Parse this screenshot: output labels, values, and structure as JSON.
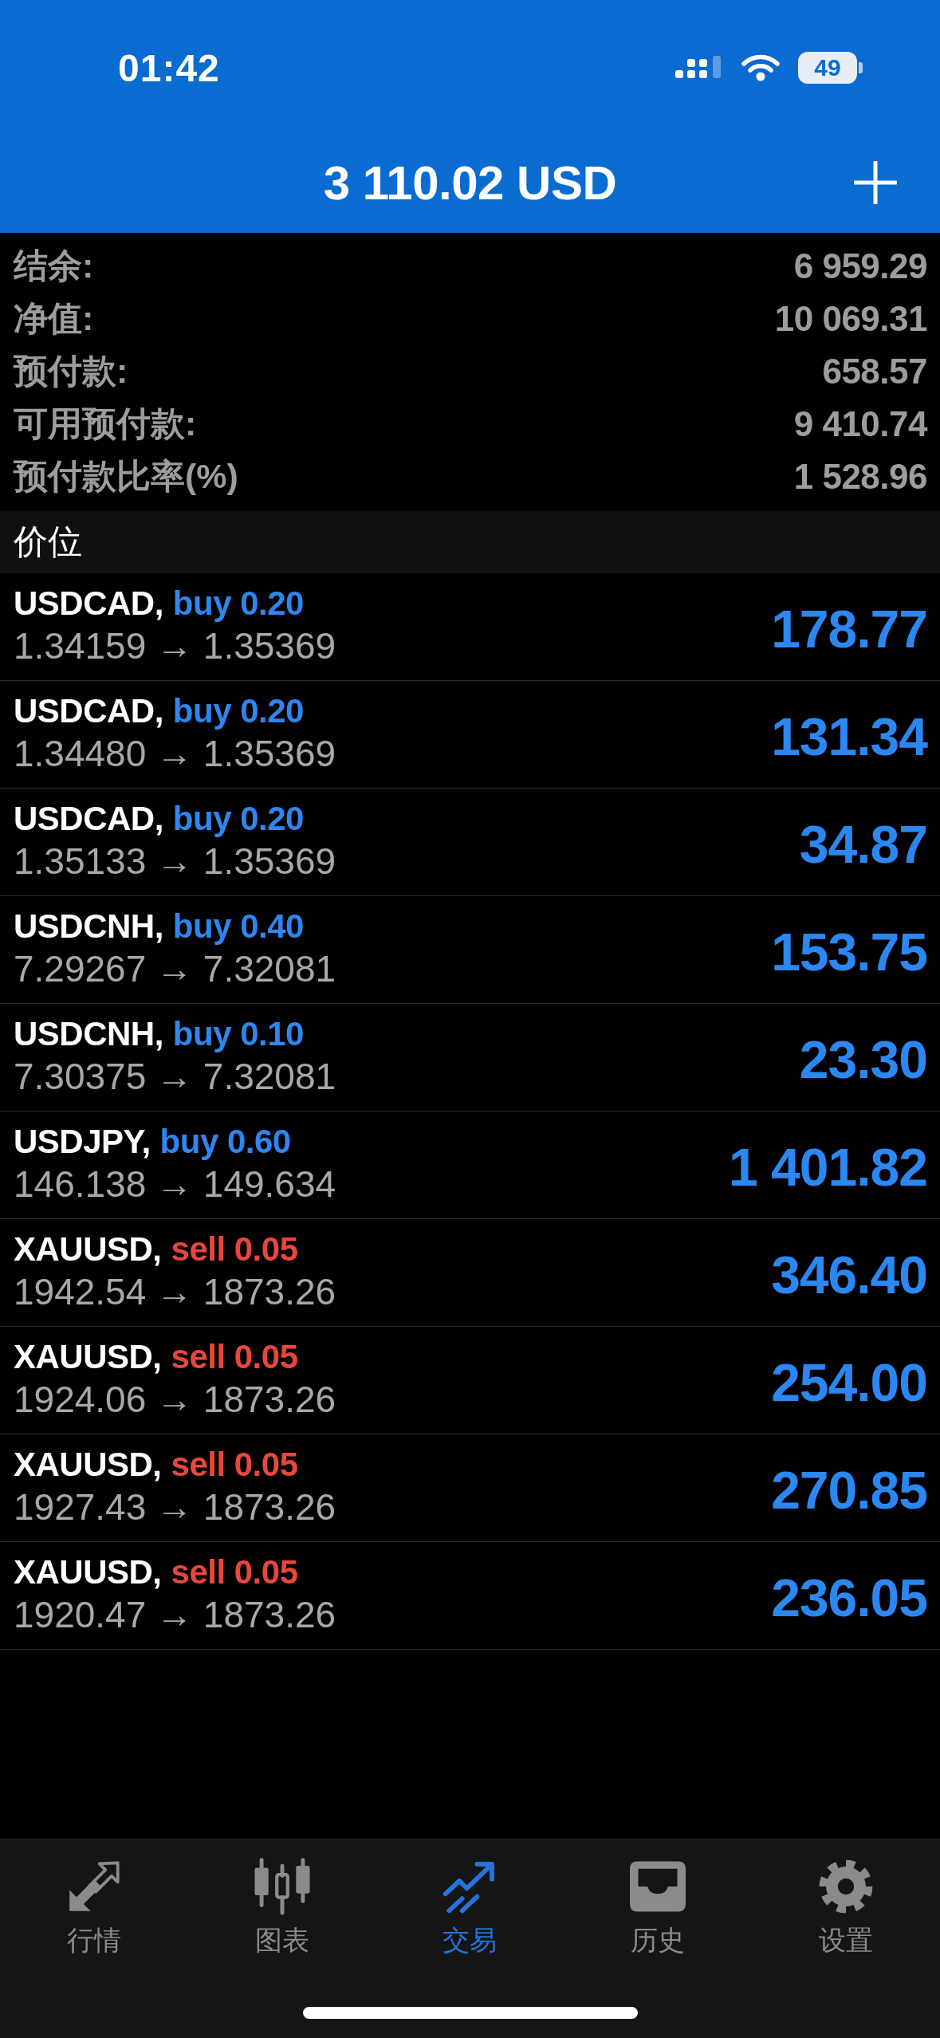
{
  "status_bar": {
    "time": "01:42",
    "battery": "49"
  },
  "header": {
    "title": "3 110.02 USD"
  },
  "summary": [
    {
      "label": "结余:",
      "value": "6 959.29"
    },
    {
      "label": "净值:",
      "value": "10 069.31"
    },
    {
      "label": "预付款:",
      "value": "658.57"
    },
    {
      "label": "可用预付款:",
      "value": "9 410.74"
    },
    {
      "label": "预付款比率(%)",
      "value": "1 528.96"
    }
  ],
  "section": {
    "title": "价位"
  },
  "positions": [
    {
      "symbol": "USDCAD,",
      "kind": "buy",
      "order": "buy 0.20",
      "prices": "1.34159 → 1.35369",
      "profit": "178.77"
    },
    {
      "symbol": "USDCAD,",
      "kind": "buy",
      "order": "buy 0.20",
      "prices": "1.34480 → 1.35369",
      "profit": "131.34"
    },
    {
      "symbol": "USDCAD,",
      "kind": "buy",
      "order": "buy 0.20",
      "prices": "1.35133 → 1.35369",
      "profit": "34.87"
    },
    {
      "symbol": "USDCNH,",
      "kind": "buy",
      "order": "buy 0.40",
      "prices": "7.29267 → 7.32081",
      "profit": "153.75"
    },
    {
      "symbol": "USDCNH,",
      "kind": "buy",
      "order": "buy 0.10",
      "prices": "7.30375 → 7.32081",
      "profit": "23.30"
    },
    {
      "symbol": "USDJPY,",
      "kind": "buy",
      "order": "buy 0.60",
      "prices": "146.138 → 149.634",
      "profit": "1 401.82"
    },
    {
      "symbol": "XAUUSD,",
      "kind": "sell",
      "order": "sell 0.05",
      "prices": "1942.54 → 1873.26",
      "profit": "346.40"
    },
    {
      "symbol": "XAUUSD,",
      "kind": "sell",
      "order": "sell 0.05",
      "prices": "1924.06 → 1873.26",
      "profit": "254.00"
    },
    {
      "symbol": "XAUUSD,",
      "kind": "sell",
      "order": "sell 0.05",
      "prices": "1927.43 → 1873.26",
      "profit": "270.85"
    },
    {
      "symbol": "XAUUSD,",
      "kind": "sell",
      "order": "sell 0.05",
      "prices": "1920.47 → 1873.26",
      "profit": "236.05"
    }
  ],
  "tab_bar": [
    {
      "label": "行情",
      "selected": false
    },
    {
      "label": "图表",
      "selected": false
    },
    {
      "label": "交易",
      "selected": true
    },
    {
      "label": "历史",
      "selected": false
    },
    {
      "label": "设置",
      "selected": false
    }
  ]
}
